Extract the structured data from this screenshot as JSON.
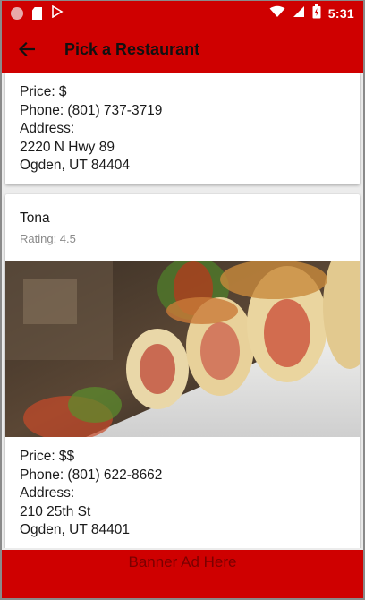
{
  "status_bar": {
    "time": "5:31"
  },
  "app_bar": {
    "title": "Pick a Restaurant"
  },
  "restaurants": [
    {
      "price": "Price: $",
      "phone": "Phone: (801) 737-3719",
      "address_label": "Address:",
      "address_line1": "2220 N Hwy 89",
      "address_line2": "Ogden, UT 84404"
    },
    {
      "name": "Tona",
      "rating": "Rating: 4.5",
      "price": "Price: $$",
      "phone": "Phone: (801) 622-8662",
      "address_label": "Address:",
      "address_line1": "210 25th St",
      "address_line2": "Ogden, UT 84401"
    }
  ],
  "banner": {
    "text": "Banner Ad Here"
  },
  "colors": {
    "primary": "#cf0000",
    "banner_text": "#7a0000"
  }
}
